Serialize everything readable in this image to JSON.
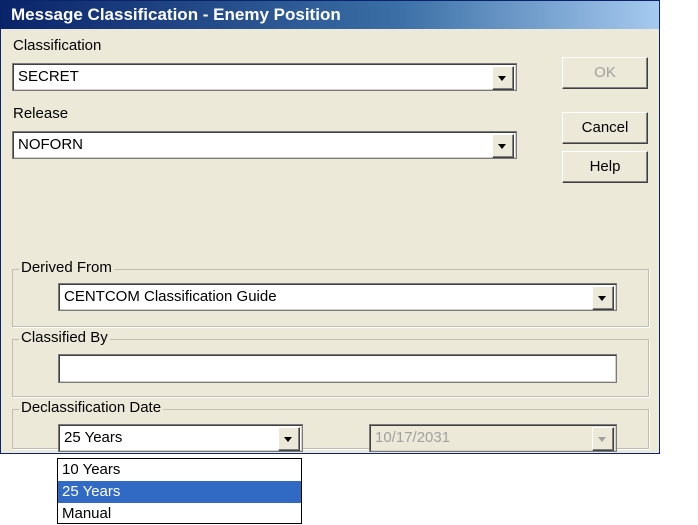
{
  "window": {
    "title": "Message Classification - Enemy Position"
  },
  "classification": {
    "label": "Classification",
    "value": "SECRET"
  },
  "release": {
    "label": "Release",
    "value": "NOFORN"
  },
  "buttons": {
    "ok": "OK",
    "cancel": "Cancel",
    "help": "Help"
  },
  "derived_from": {
    "legend": "Derived From",
    "value": "CENTCOM Classification Guide"
  },
  "classified_by": {
    "legend": "Classified By",
    "value": ""
  },
  "declassification": {
    "legend": "Declassification Date",
    "selected": "25 Years",
    "date": "10/17/2031",
    "options": [
      {
        "label": "10 Years",
        "selected": false
      },
      {
        "label": "25 Years",
        "selected": true
      },
      {
        "label": "Manual",
        "selected": false
      }
    ]
  }
}
